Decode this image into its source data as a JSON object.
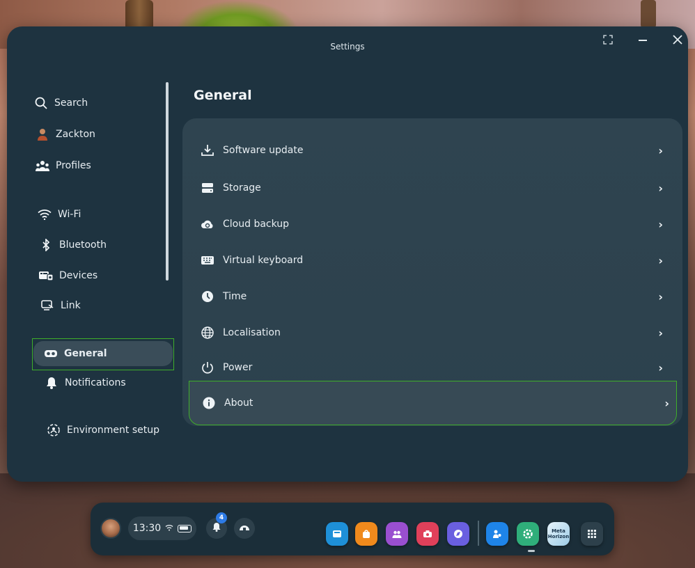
{
  "window": {
    "title": "Settings",
    "controls": {
      "expand_icon": "expand-icon",
      "minimize_icon": "minimize-icon",
      "close_icon": "close-icon"
    }
  },
  "sidebar": {
    "items": [
      {
        "label": "Search",
        "icon": "search-icon"
      },
      {
        "label": "Zackton",
        "icon": "user-avatar-icon"
      },
      {
        "label": "Profiles",
        "icon": "profiles-icon"
      },
      {
        "label": "Wi-Fi",
        "icon": "wifi-icon"
      },
      {
        "label": "Bluetooth",
        "icon": "bluetooth-icon"
      },
      {
        "label": "Devices",
        "icon": "devices-icon"
      },
      {
        "label": "Link",
        "icon": "link-icon"
      },
      {
        "label": "General",
        "icon": "headset-icon",
        "selected": true
      },
      {
        "label": "Notifications",
        "icon": "bell-icon"
      },
      {
        "label": "Environment setup",
        "icon": "environment-icon"
      }
    ]
  },
  "main": {
    "title": "General",
    "rows": [
      {
        "label": "Software update",
        "icon": "download-icon"
      },
      {
        "label": "Storage",
        "icon": "storage-icon"
      },
      {
        "label": "Cloud backup",
        "icon": "cloud-icon"
      },
      {
        "label": "Virtual keyboard",
        "icon": "keyboard-icon"
      },
      {
        "label": "Time",
        "icon": "clock-icon"
      },
      {
        "label": "Localisation",
        "icon": "globe-icon"
      },
      {
        "label": "Power",
        "icon": "power-icon"
      },
      {
        "label": "About",
        "icon": "info-icon",
        "highlighted": true
      }
    ]
  },
  "taskbar": {
    "time": "13:30",
    "notification_count": "4",
    "meta_horizon_label": "Meta Horizon",
    "apps": [
      {
        "name": "store-app",
        "color": "#1e90d8"
      },
      {
        "name": "shop-app",
        "color": "#f08a1c"
      },
      {
        "name": "people-app",
        "color": "#9a4fd0"
      },
      {
        "name": "camera-app",
        "color": "#e0405a"
      },
      {
        "name": "explore-app",
        "color": "#6a5fe0"
      },
      {
        "name": "social-app",
        "color": "#1e84e8"
      },
      {
        "name": "settings-app",
        "color": "#2fae7a"
      },
      {
        "name": "meta-horizon-app",
        "color": "#bfe0f2"
      },
      {
        "name": "app-library",
        "color": "#2d404b"
      }
    ]
  },
  "colors": {
    "window_bg": "#1e3340",
    "card_bg": "#2f4450",
    "highlight_outline": "#3fae2a",
    "badge_blue": "#2d7be6"
  }
}
